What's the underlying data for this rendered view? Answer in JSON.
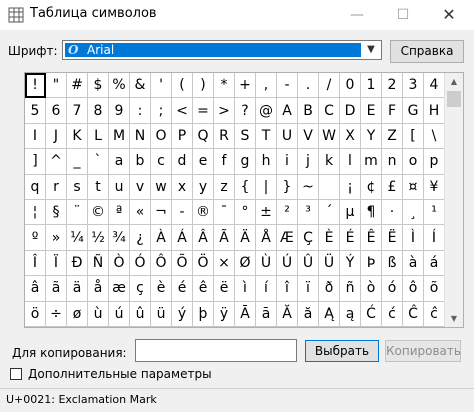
{
  "window": {
    "title": "Таблица символов"
  },
  "font": {
    "label": "Шрифт:",
    "selected_value": "Arial"
  },
  "buttons": {
    "help": "Справка",
    "select": "Выбрать",
    "copy": "Копировать"
  },
  "copy": {
    "label": "Для копирования:",
    "value": ""
  },
  "advanced": {
    "label": "Дополнительные параметры",
    "checked": false
  },
  "status": {
    "text": "U+0021: Exclamation Mark"
  },
  "characters": [
    "!",
    "\"",
    "#",
    "$",
    "%",
    "&",
    "'",
    "(",
    ")",
    "*",
    "+",
    ",",
    "-",
    ".",
    "/",
    "0",
    "1",
    "2",
    "3",
    "4",
    "5",
    "6",
    "7",
    "8",
    "9",
    ":",
    ";",
    "<",
    "=",
    ">",
    "?",
    "@",
    "A",
    "B",
    "C",
    "D",
    "E",
    "F",
    "G",
    "H",
    "I",
    "J",
    "K",
    "L",
    "M",
    "N",
    "O",
    "P",
    "Q",
    "R",
    "S",
    "T",
    "U",
    "V",
    "W",
    "X",
    "Y",
    "Z",
    "[",
    "\\",
    "]",
    "^",
    "_",
    "`",
    "a",
    "b",
    "c",
    "d",
    "e",
    "f",
    "g",
    "h",
    "i",
    "j",
    "k",
    "l",
    "m",
    "n",
    "o",
    "p",
    "q",
    "r",
    "s",
    "t",
    "u",
    "v",
    "w",
    "x",
    "y",
    "z",
    "{",
    "|",
    "}",
    "~",
    "",
    "¡",
    "¢",
    "£",
    "¤",
    "¥",
    "¦",
    "§",
    "¨",
    "©",
    "ª",
    "«",
    "¬",
    "-",
    "®",
    "¯",
    "°",
    "±",
    "²",
    "³",
    "´",
    "µ",
    "¶",
    "·",
    "¸",
    "¹",
    "º",
    "»",
    "¼",
    "½",
    "¾",
    "¿",
    "À",
    "Á",
    "Â",
    "Ã",
    "Ä",
    "Å",
    "Æ",
    "Ç",
    "È",
    "É",
    "Ê",
    "Ë",
    "Ì",
    "Í",
    "Î",
    "Ï",
    "Ð",
    "Ñ",
    "Ò",
    "Ó",
    "Ô",
    "Õ",
    "Ö",
    "×",
    "Ø",
    "Ù",
    "Ú",
    "Û",
    "Ü",
    "Ý",
    "Þ",
    "ß",
    "à",
    "á",
    "â",
    "ã",
    "ä",
    "å",
    "æ",
    "ç",
    "è",
    "é",
    "ê",
    "ë",
    "ì",
    "í",
    "î",
    "ï",
    "ð",
    "ñ",
    "ò",
    "ó",
    "ô",
    "õ",
    "ö",
    "÷",
    "ø",
    "ù",
    "ú",
    "û",
    "ü",
    "ý",
    "þ",
    "ÿ",
    "Ā",
    "ā",
    "Ă",
    "ă",
    "Ą",
    "ą",
    "Ć",
    "ć",
    "Ĉ",
    "ĉ"
  ],
  "selected_index": 0,
  "icons": {
    "app": "character-map-icon",
    "minimize": "minimize-icon",
    "maximize": "maximize-icon",
    "close": "close-icon",
    "font": "opentype-font-icon",
    "dropdown": "chevron-down-icon"
  }
}
